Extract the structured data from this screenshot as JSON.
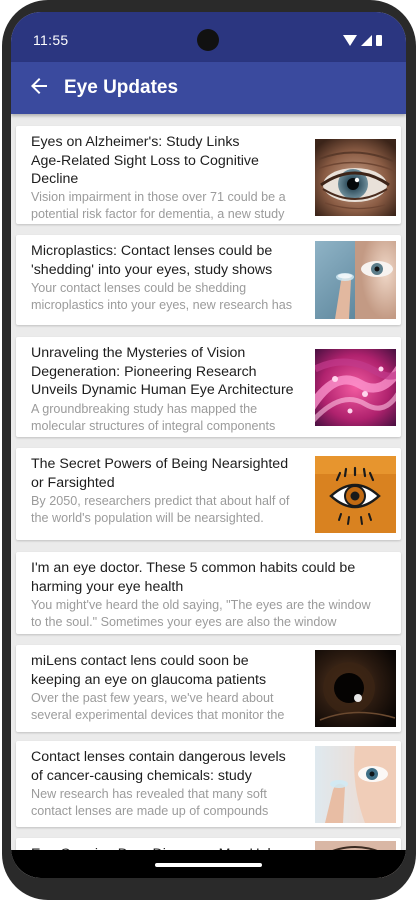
{
  "status": {
    "time": "11:55",
    "icons": [
      "wifi-icon",
      "signal-icon",
      "battery-icon"
    ]
  },
  "appbar": {
    "back_icon": "arrow-left-icon",
    "title": "Eye Updates",
    "color": "#3a4a9e",
    "status_color": "#2b3680"
  },
  "articles": [
    {
      "title_lines": [
        "Eyes on Alzheimer's: Study Links",
        "Age-Related Sight Loss to Cognitive",
        "Decline"
      ],
      "desc_lines": [
        "Vision impairment in those over 71 could be a",
        "potential risk factor for dementia, a new study"
      ],
      "image": "aged-eye-closeup-image"
    },
    {
      "title_lines": [
        "Microplastics: Contact lenses could be",
        "'shedding' into your eyes, study shows"
      ],
      "desc_lines": [
        "Your contact lenses could be shedding",
        "microplastics into your eyes, new research has"
      ],
      "image": "contact-lens-on-finger-image"
    },
    {
      "title_lines": [
        "Unraveling the Mysteries of Vision",
        "Degeneration: Pioneering Research",
        "Unveils Dynamic Human Eye Architecture"
      ],
      "desc_lines": [
        "A groundbreaking study has mapped the",
        "molecular structures of integral components"
      ],
      "image": "pink-molecular-structure-image"
    },
    {
      "title_lines": [
        "The Secret Powers of Being Nearsighted",
        "or Farsighted"
      ],
      "desc_lines": [
        "By 2050, researchers predict that about half of",
        "the world's population will be nearsighted."
      ],
      "image": "cartoon-eye-orange-image"
    },
    {
      "title_lines": [
        "I'm an eye doctor. These 5 common habits could be",
        "harming your eye health"
      ],
      "desc_lines": [
        "You might've heard the old saying, \"The eyes are the window",
        "to the soul.\" Sometimes your eyes are also the window"
      ],
      "image": ""
    },
    {
      "title_lines": [
        "miLens contact lens could soon be",
        "keeping an eye on glaucoma patients"
      ],
      "desc_lines": [
        "Over the past few years, we've heard about",
        "several experimental devices that monitor the"
      ],
      "image": "dark-eye-lens-image"
    },
    {
      "title_lines": [
        "Contact lenses contain dangerous levels",
        "of cancer-causing chemicals: study"
      ],
      "desc_lines": [
        "New research has revealed that many soft",
        "contact lenses are made up of compounds"
      ],
      "image": "contact-lens-insertion-image"
    },
    {
      "title_lines": [
        "Eye-Opening Drug Discovery May Help"
      ],
      "desc_lines": [],
      "image": "eye-closeup-image"
    }
  ]
}
